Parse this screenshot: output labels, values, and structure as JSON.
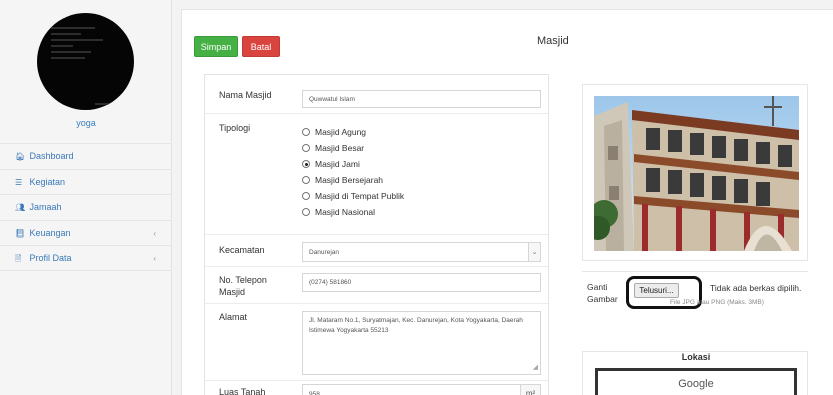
{
  "sidebar": {
    "username": "yoga",
    "items": [
      {
        "label": "Dashboard",
        "icon": "home-icon",
        "glyph": "🏠︎",
        "chevron": ""
      },
      {
        "label": "Kegiatan",
        "icon": "list-icon",
        "glyph": "☰",
        "chevron": ""
      },
      {
        "label": "Jamaah",
        "icon": "users-icon",
        "glyph": "👥︎",
        "chevron": ""
      },
      {
        "label": "Keuangan",
        "icon": "book-icon",
        "glyph": "📘︎",
        "chevron": "‹"
      },
      {
        "label": "Profil Data",
        "icon": "document-icon",
        "glyph": "🗎",
        "chevron": "‹"
      }
    ]
  },
  "toolbar": {
    "save_label": "Simpan",
    "cancel_label": "Batal"
  },
  "page": {
    "title": "Masjid"
  },
  "form": {
    "nama_label": "Nama Masjid",
    "nama_value": "Quwwatul Islam",
    "tipologi_label": "Tipologi",
    "tipologi_options": [
      {
        "label": "Masjid Agung",
        "selected": false
      },
      {
        "label": "Masjid Besar",
        "selected": false
      },
      {
        "label": "Masjid Jami",
        "selected": true
      },
      {
        "label": "Masjid Bersejarah",
        "selected": false
      },
      {
        "label": "Masjid di Tempat Publik",
        "selected": false
      },
      {
        "label": "Masjid Nasional",
        "selected": false
      }
    ],
    "kecamatan_label": "Kecamatan",
    "kecamatan_value": "Danurejan",
    "telepon_label_1": "No. Telepon",
    "telepon_label_2": "Masjid",
    "telepon_value": "(0274) 581860",
    "alamat_label": "Alamat",
    "alamat_value": "Jl. Mataram No.1, Suryatmajan, Kec. Danurejan, Kota Yogyakarta, Daerah Istimewa Yogyakarta 55213",
    "luas_label": "Luas Tanah",
    "luas_value": "958",
    "luas_unit": "m²"
  },
  "image_upload": {
    "ganti_label_1": "Ganti",
    "ganti_label_2": "Gambar",
    "browse_label": "Telusuri...",
    "no_file_text": "Tidak ada berkas dipilih.",
    "file_info": "File JPG atau PNG (Maks. 3MB)"
  },
  "map": {
    "title": "Lokasi",
    "provider": "Google"
  }
}
